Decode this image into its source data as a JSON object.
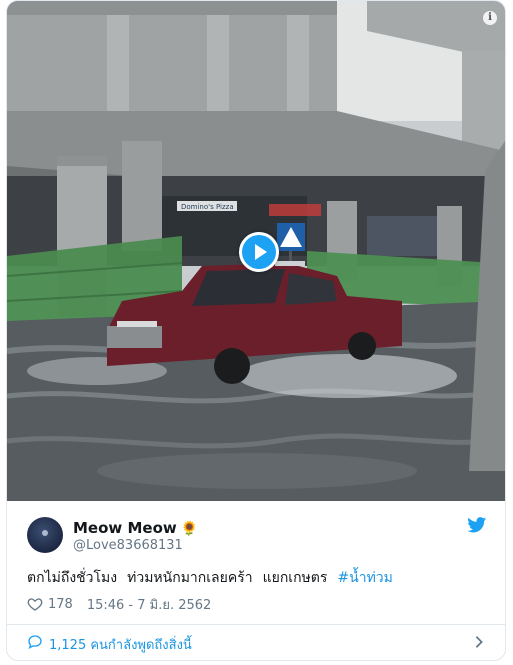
{
  "media": {
    "storefront_sign": "Domino's Pizza",
    "info_glyph": "i",
    "play_icon": "play-icon"
  },
  "author": {
    "display_name": "Meow Meow",
    "emoji": "🌻",
    "handle": "@Love83668131"
  },
  "tweet": {
    "text_parts": [
      "ตกไม่ถึงชั่วโมง",
      "ท่วมหนักมากเลยคร้า",
      "แยกเกษตร"
    ],
    "hashtag": "#น้ำท่วม"
  },
  "meta": {
    "likes": "178",
    "timestamp": "15:46 - 7 มิ.ย. 2562"
  },
  "footer": {
    "conversation": "1,125 คนกำลังพูดถึงสิ่งนี้"
  },
  "colors": {
    "accent": "#1da1f2",
    "link": "#1b95e0",
    "muted": "#657786"
  },
  "icons": [
    "info-icon",
    "play-icon",
    "twitter-bird-icon",
    "heart-icon",
    "chat-bubble-icon",
    "chevron-right-icon"
  ]
}
